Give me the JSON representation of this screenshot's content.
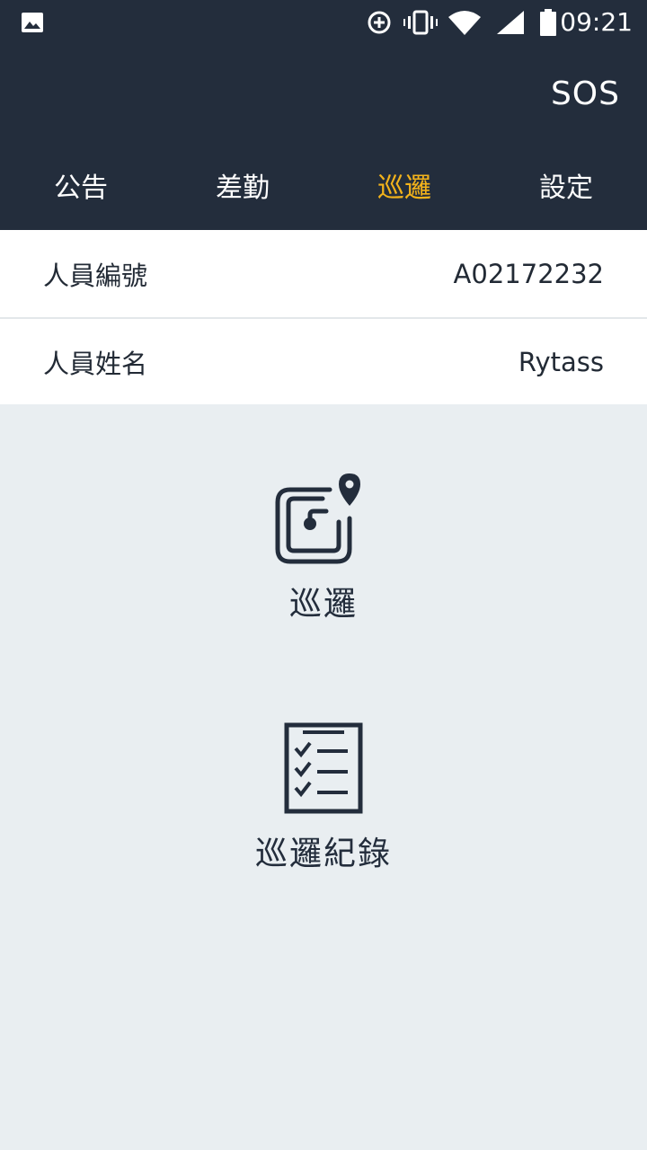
{
  "status_bar": {
    "icons": [
      "image-icon",
      "data-saver-icon",
      "vibrate-icon",
      "wifi-icon",
      "signal-icon",
      "battery-icon"
    ],
    "time": "09:21"
  },
  "header": {
    "sos_label": "SOS",
    "tabs": [
      {
        "label": "公告",
        "active": false
      },
      {
        "label": "差勤",
        "active": false
      },
      {
        "label": "巡邏",
        "active": true
      },
      {
        "label": "設定",
        "active": false
      }
    ],
    "active_color": "#f2b21b",
    "background_color": "#232d3c"
  },
  "info": {
    "rows": [
      {
        "label": "人員編號",
        "value": "A02172232"
      },
      {
        "label": "人員姓名",
        "value": "Rytass"
      }
    ]
  },
  "actions": [
    {
      "label": "巡邏",
      "icon": "nfc-location-icon"
    },
    {
      "label": "巡邏紀錄",
      "icon": "checklist-clipboard-icon"
    }
  ]
}
